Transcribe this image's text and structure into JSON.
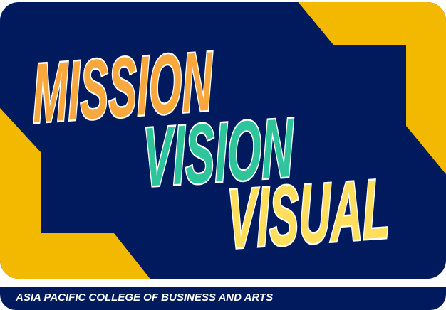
{
  "banner": {
    "words": [
      "MISSION",
      "VISION",
      "VISUAL"
    ],
    "footer": "ASIA PACIFIC COLLEGE OF BUSINESS AND ARTS"
  },
  "colors": {
    "navy": "#001a5e",
    "gold": "#f2b900",
    "orange": "#f9a83e",
    "teal": "#2ec59c",
    "yellow": "#ffde5c"
  }
}
